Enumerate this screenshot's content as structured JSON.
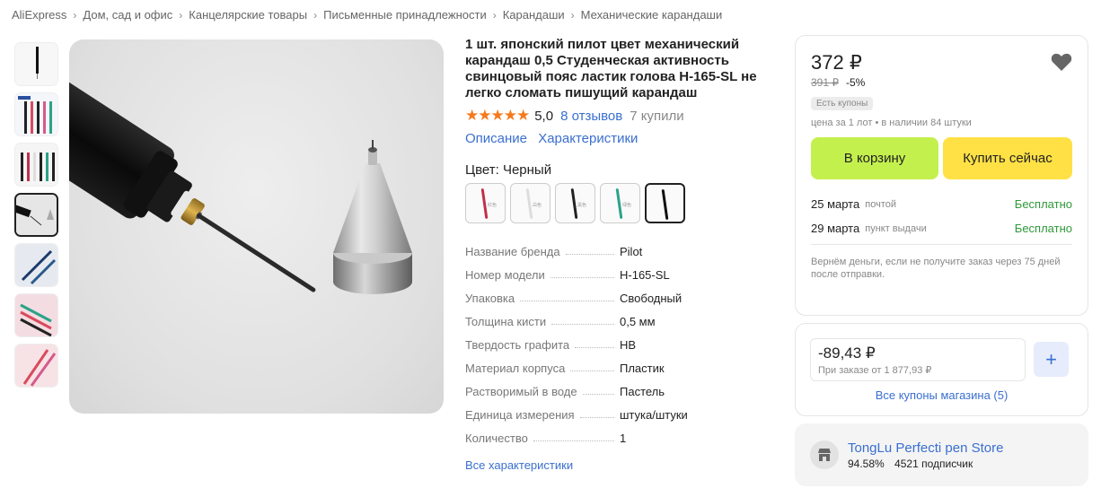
{
  "breadcrumbs": [
    "AliExpress",
    "Дом, сад и офис",
    "Канцелярские товары",
    "Письменные принадлежности",
    "Карандаши",
    "Механические карандаши"
  ],
  "product": {
    "title": "1 шт. японский пилот цвет механический карандаш 0,5 Студенческая активность свинцовый пояс ластик голова H-165-SL не легко сломать пишущий карандаш",
    "stars": "★★★★★",
    "rating": "5,0",
    "reviews": "8 отзывов",
    "bought": "7 купили",
    "tab_description": "Описание",
    "tab_specs": "Характеристики",
    "color_label": "Цвет: Черный",
    "swatch_texts": [
      "红色",
      "白色",
      "黑色",
      "绿色",
      ""
    ],
    "swatch_colors": [
      "#c0304a",
      "#dddddd",
      "#222222",
      "#2aa388",
      "#111111"
    ],
    "specs": [
      {
        "k": "Название бренда",
        "v": "Pilot"
      },
      {
        "k": "Номер модели",
        "v": "H-165-SL"
      },
      {
        "k": "Упаковка",
        "v": "Свободный"
      },
      {
        "k": "Толщина кисти",
        "v": "0,5 мм"
      },
      {
        "k": "Твердость графита",
        "v": "HB"
      },
      {
        "k": "Материал корпуса",
        "v": "Пластик"
      },
      {
        "k": "Растворимый в воде",
        "v": "Пастель"
      },
      {
        "k": "Единица измерения",
        "v": "штука/штуки"
      },
      {
        "k": "Количество",
        "v": "1"
      }
    ],
    "all_specs": "Все характеристики"
  },
  "buy_box": {
    "price": "372 ₽",
    "old_price": "391 ₽",
    "discount": "-5%",
    "coupon_badge": "Есть купоны",
    "lot_info": "цена за 1 лот • в наличии 84 штуки",
    "cart_button": "В корзину",
    "buy_now_button": "Купить сейчас",
    "delivery": [
      {
        "date": "25 марта",
        "type": "почтой",
        "price": "Бесплатно"
      },
      {
        "date": "29 марта",
        "type": "пункт выдачи",
        "price": "Бесплатно"
      }
    ],
    "refund": "Вернём деньги, если не получите заказ через 75 дней после отправки."
  },
  "coupon": {
    "amount": "-89,43 ₽",
    "condition": "При заказе от 1 877,93 ₽",
    "plus": "+",
    "all_coupons": "Все купоны магазина (5)"
  },
  "store": {
    "name": "TongLu Perfecti pen Store",
    "rating": "94.58%",
    "subscribers": "4521 подписчик"
  },
  "colors": {
    "accent_link": "#3a6fd0",
    "star": "#f57a1d",
    "cart_btn": "#c4f04e",
    "buy_btn": "#ffe145",
    "free": "#2f9a3a"
  }
}
